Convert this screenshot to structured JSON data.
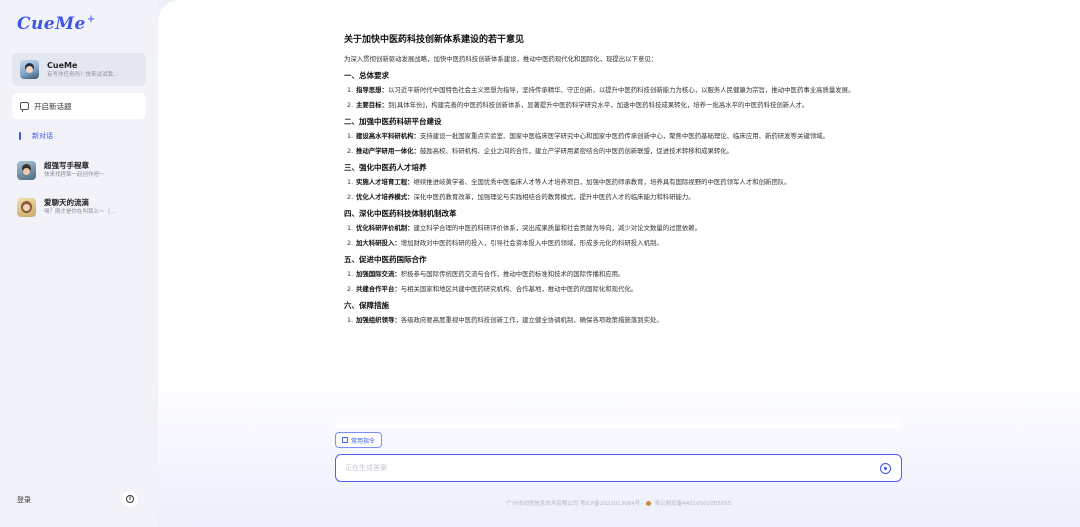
{
  "app": {
    "logo": "CueMe",
    "logo_mark": "+"
  },
  "sidebar": {
    "agent": {
      "name": "CueMe",
      "subtitle": "有写作任务吗？快来试试我..."
    },
    "new_chat_label": "开启新话题",
    "current_chat_label": "新对话",
    "history": [
      {
        "title": "超强写手程章",
        "subtitle": "快来找程章一起创作吧～"
      },
      {
        "title": "爱聊天的流滴",
        "subtitle": "嘿？刚才是你在叫我么～（..."
      }
    ],
    "login_label": "登录",
    "info_icon": "i"
  },
  "document": {
    "title": "关于加快中医药科技创新体系建设的若干意见",
    "intro": "为深入贯彻创新驱动发展战略，加快中医药科技创新体系建设，推动中医药现代化和国际化，现提出以下意见：",
    "sections": [
      {
        "heading": "一、总体要求",
        "items": [
          {
            "num": "1.",
            "label": "指导思想：",
            "text": "以习近平新时代中国特色社会主义思想为指导，坚持传承精华、守正创新，以提升中医药科技创新能力为核心，以服务人民健康为宗旨，推动中医药事业高质量发展。"
          },
          {
            "num": "2.",
            "label": "主要目标：",
            "text": "到[具体年份]，构建完善的中医药科技创新体系，显著提升中医药科学研究水平，加速中医药科技成果转化，培养一批高水平的中医药科技创新人才。"
          }
        ]
      },
      {
        "heading": "二、加强中医药科研平台建设",
        "items": [
          {
            "num": "1.",
            "label": "建设高水平科研机构：",
            "text": "支持建设一批国家重点实验室、国家中医临床医学研究中心和国家中医药传承创新中心，聚焦中医药基础理论、临床应用、新药研发等关键领域。"
          },
          {
            "num": "2.",
            "label": "推动产学研用一体化：",
            "text": "鼓励高校、科研机构、企业之间的合作，建立产学研用紧密结合的中医药创新联盟，促进技术转移和成果转化。"
          }
        ]
      },
      {
        "heading": "三、强化中医药人才培养",
        "items": [
          {
            "num": "1.",
            "label": "实施人才培育工程：",
            "text": "继续推进岐黄学者、全国优秀中医临床人才等人才培养项目，加强中医药师承教育，培养具有国际视野的中医药领军人才和创新团队。"
          },
          {
            "num": "2.",
            "label": "优化人才培养模式：",
            "text": "深化中医药教育改革，加强理论与实践相结合的教育模式，提升中医药人才的临床能力和科研能力。"
          }
        ]
      },
      {
        "heading": "四、深化中医药科技体制机制改革",
        "items": [
          {
            "num": "1.",
            "label": "优化科研评价机制：",
            "text": "建立科学合理的中医药科研评价体系，突出成果质量和社会贡献为导向，减少对论文数量的过度依赖。"
          },
          {
            "num": "2.",
            "label": "加大科研投入：",
            "text": "增加财政对中医药科研的投入，引导社会资本投入中医药领域，形成多元化的科研投入机制。"
          }
        ]
      },
      {
        "heading": "五、促进中医药国际合作",
        "items": [
          {
            "num": "1.",
            "label": "加强国际交流：",
            "text": "积极参与国际传统医药交流与合作，推动中医药标准和技术的国际传播和应用。"
          },
          {
            "num": "2.",
            "label": "共建合作平台：",
            "text": "与相关国家和地区共建中医药研究机构、合作基地，推动中医药的国际化和现代化。"
          }
        ]
      },
      {
        "heading": "六、保障措施",
        "items": [
          {
            "num": "1.",
            "label": "加强组织领导：",
            "text": "各级政府要高度重视中医药科技创新工作，建立健全协调机制，确保各项政策措施落到实处。"
          }
        ]
      }
    ]
  },
  "composer": {
    "command_button_label": "常用指令",
    "input_placeholder": "正在生成答案",
    "input_value": ""
  },
  "footer": {
    "company": "广州市动悦信息技术有限公司 粤ICP备2022013084号",
    "police": "粤公网安备44010502003055"
  },
  "colors": {
    "accent": "#3d56e8",
    "sidebar_bg": "#f1f3f9"
  }
}
